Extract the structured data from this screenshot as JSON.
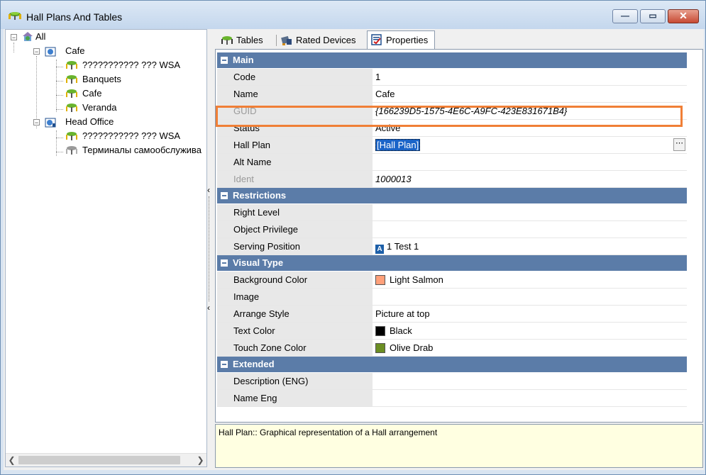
{
  "window": {
    "title": "Hall Plans And Tables",
    "buttons": [
      "minimize",
      "maximize",
      "close"
    ]
  },
  "tree": {
    "root": "All",
    "nodes": [
      {
        "label": "Cafe",
        "level": 1,
        "icon": "building-icon"
      },
      {
        "label": "??????????? ??? WSA",
        "level": 2,
        "icon": "table-icon"
      },
      {
        "label": "Banquets",
        "level": 2,
        "icon": "table-icon"
      },
      {
        "label": "Cafe",
        "level": 2,
        "icon": "table-icon"
      },
      {
        "label": "Veranda",
        "level": 2,
        "icon": "table-icon"
      },
      {
        "label": "Head Office",
        "level": 1,
        "icon": "building-icon"
      },
      {
        "label": "??????????? ??? WSA",
        "level": 2,
        "icon": "table-icon"
      },
      {
        "label": "Терминалы самообслужива",
        "level": 2,
        "icon": "table-gray-icon"
      }
    ]
  },
  "tabs": [
    {
      "label": "Tables",
      "active": false
    },
    {
      "label": "Rated Devices",
      "active": false
    },
    {
      "label": "Properties",
      "active": true
    }
  ],
  "sections": {
    "main": "Main",
    "restrictions": "Restrictions",
    "visual": "Visual Type",
    "extended": "Extended"
  },
  "props": {
    "code": {
      "name": "Code",
      "value": "1"
    },
    "name": {
      "name": "Name",
      "value": "Cafe"
    },
    "guid": {
      "name": "GUID",
      "value": "{166239D5-1575-4E6C-A9FC-423E831671B4}"
    },
    "status": {
      "name": "Status",
      "value": "Active"
    },
    "hall_plan": {
      "name": "Hall Plan",
      "value": "[Hall Plan]"
    },
    "alt_name": {
      "name": "Alt Name",
      "value": ""
    },
    "ident": {
      "name": "Ident",
      "value": "1000013"
    },
    "right_level": {
      "name": "Right Level",
      "value": ""
    },
    "object_privilege": {
      "name": "Object Privilege",
      "value": ""
    },
    "serving_position": {
      "name": "Serving Position",
      "value": "1 Test 1",
      "badge": "A"
    },
    "background_color": {
      "name": "Background Color",
      "value": "Light Salmon",
      "color": "#FFA07A"
    },
    "image": {
      "name": "Image",
      "value": ""
    },
    "arrange_style": {
      "name": "Arrange Style",
      "value": "Picture at top"
    },
    "text_color": {
      "name": "Text Color",
      "value": "Black",
      "color": "#000000"
    },
    "touch_zone_color": {
      "name": "Touch Zone Color",
      "value": "Olive Drab",
      "color": "#6B8E23"
    },
    "description_eng": {
      "name": "Description (ENG)",
      "value": ""
    },
    "name_eng": {
      "name": "Name Eng",
      "value": ""
    }
  },
  "description": "Hall Plan:: Graphical representation of a Hall arrangement",
  "colors": {
    "section_header": "#5B7CA8",
    "selection": "#1A64C8",
    "highlight": "#F07F36",
    "description_bg": "#FFFFE1"
  }
}
